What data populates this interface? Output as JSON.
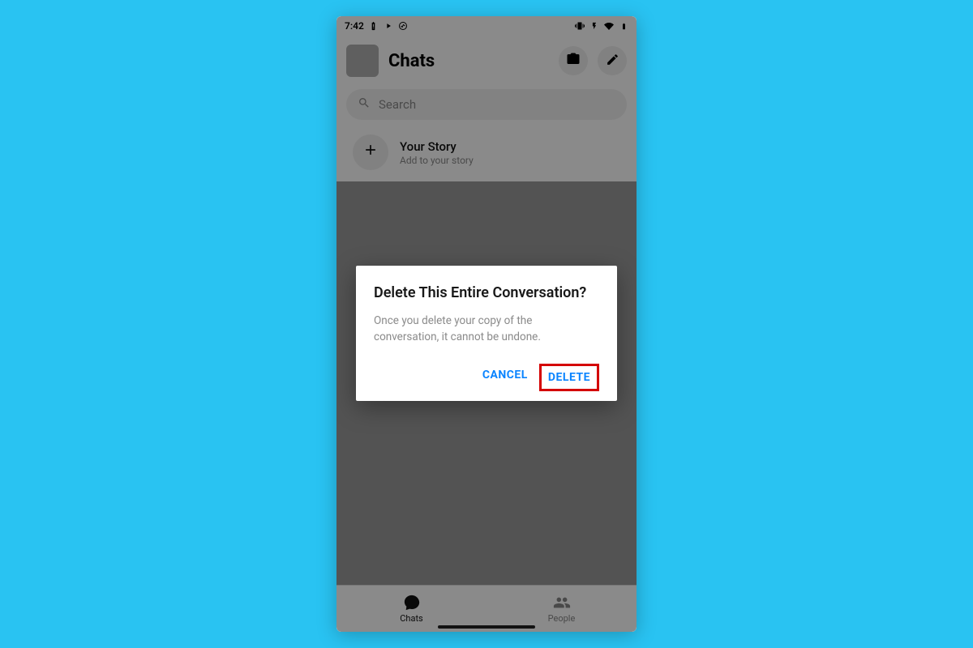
{
  "status": {
    "time": "7:42"
  },
  "header": {
    "title": "Chats"
  },
  "search": {
    "placeholder": "Search"
  },
  "story": {
    "title": "Your Story",
    "subtitle": "Add to your story"
  },
  "dialog": {
    "title": "Delete This Entire Conversation?",
    "body": "Once you delete your copy of the conversation, it cannot be undone.",
    "cancel": "CANCEL",
    "delete": "DELETE"
  },
  "nav": {
    "chats": "Chats",
    "people": "People"
  }
}
